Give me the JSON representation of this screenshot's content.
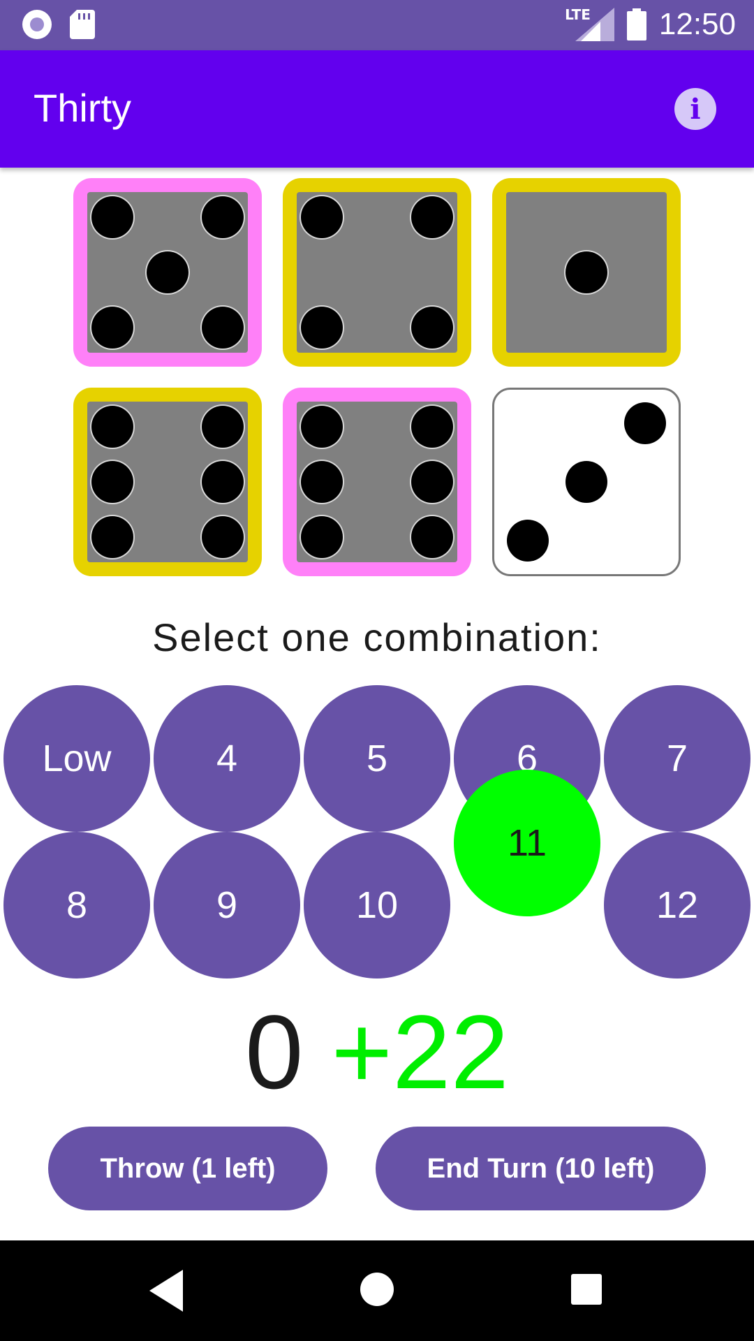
{
  "status_bar": {
    "network_label": "LTE",
    "time": "12:50",
    "icons": [
      "notification-circle-icon",
      "sd-card-icon",
      "signal-icon",
      "battery-icon"
    ]
  },
  "app_bar": {
    "title": "Thirty",
    "info_symbol": "i"
  },
  "colors": {
    "status_bar": "#6752a7",
    "app_bar": "#6200ee",
    "button": "#6752a7",
    "selected_combo": "#00ff00",
    "die_highlight_pink": "#ff80f8",
    "die_highlight_yellow": "#e6d200"
  },
  "dice": [
    {
      "value": 5,
      "highlight": "pink",
      "style": "held"
    },
    {
      "value": 4,
      "highlight": "yellow",
      "style": "held"
    },
    {
      "value": 1,
      "highlight": "yellow",
      "style": "held"
    },
    {
      "value": 6,
      "highlight": "yellow",
      "style": "held"
    },
    {
      "value": 6,
      "highlight": "pink",
      "style": "held"
    },
    {
      "value": 3,
      "highlight": "none",
      "style": "white"
    }
  ],
  "prompt": "Select one combination:",
  "combinations": [
    {
      "label": "Low"
    },
    {
      "label": "4"
    },
    {
      "label": "5"
    },
    {
      "label": "6"
    },
    {
      "label": "7"
    },
    {
      "label": "8"
    },
    {
      "label": "9"
    },
    {
      "label": "10"
    },
    {
      "label": "11",
      "selected": true
    },
    {
      "label": "12"
    }
  ],
  "score": {
    "base": "0",
    "bonus": "+22"
  },
  "buttons": {
    "throw": "Throw (1 left)",
    "end_turn": "End Turn (10 left)"
  }
}
